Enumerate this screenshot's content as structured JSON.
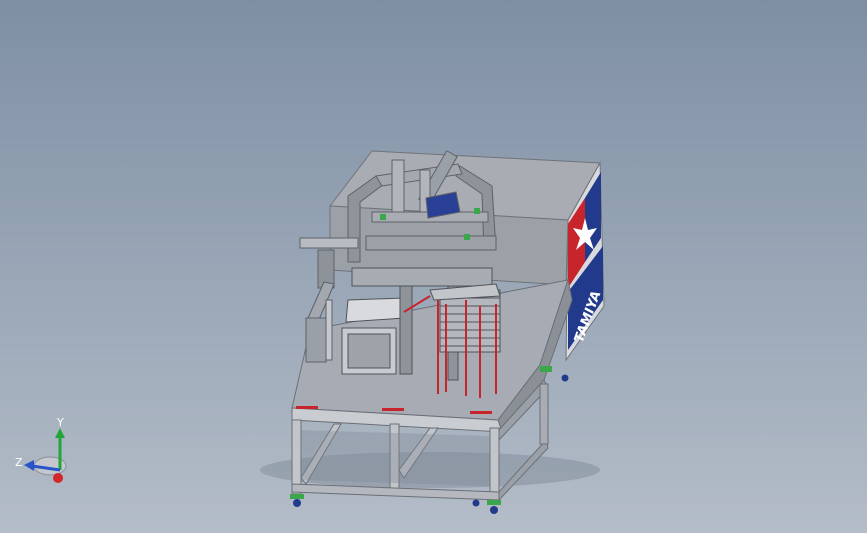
{
  "viewport": {
    "background_top": "#7f8fa3",
    "background_bottom": "#b4bdc8"
  },
  "model": {
    "logo_text": "TAMIYA",
    "colors": {
      "frame": "#b9bdc4",
      "frame_dark": "#8c9097",
      "table_top": "#a8adb5",
      "enclosure": "#aeb2b8",
      "accent_red": "#c8242c",
      "accent_blue": "#223a8c",
      "accent_green": "#3aa84a"
    }
  },
  "triad": {
    "labels": {
      "x": "",
      "y": "Y",
      "z": "Z"
    },
    "colors": {
      "x": "#d2262a",
      "y": "#22a53a",
      "z": "#2a55c8"
    }
  }
}
